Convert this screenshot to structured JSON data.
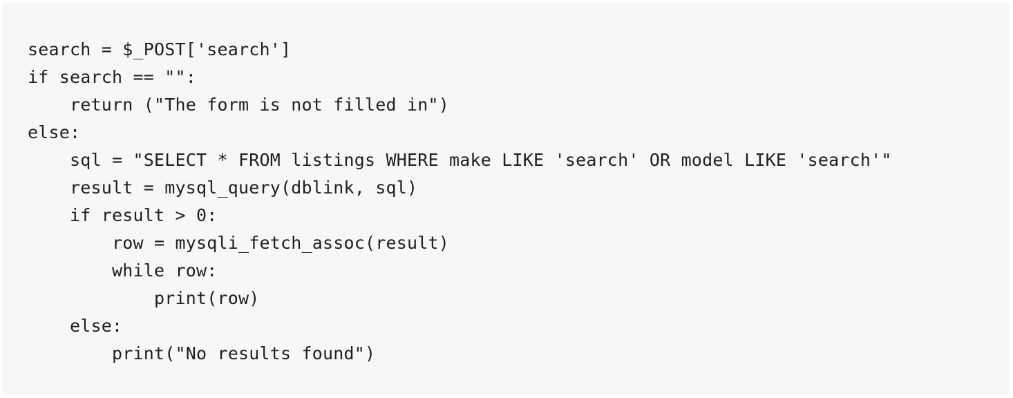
{
  "code": {
    "lines": [
      "search = $_POST['search']",
      "if search == \"\":",
      "    return (\"The form is not filled in\")",
      "else:",
      "    sql = \"SELECT * FROM listings WHERE make LIKE 'search' OR model LIKE 'search'\"",
      "    result = mysql_query(dblink, sql)",
      "    if result > 0:",
      "        row = mysqli_fetch_assoc(result)",
      "        while row:",
      "            print(row)",
      "    else:",
      "        print(\"No results found\")"
    ]
  }
}
